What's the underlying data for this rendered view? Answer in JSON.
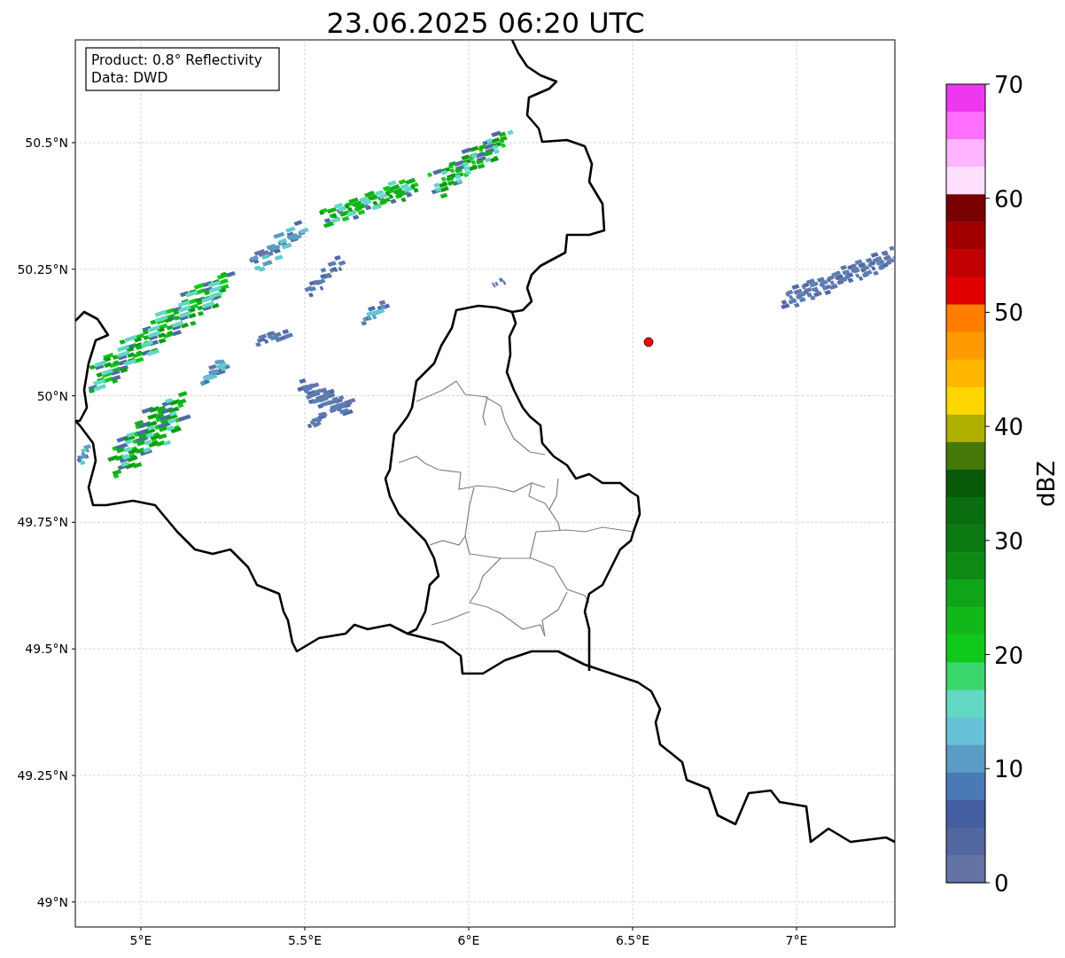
{
  "title": "23.06.2025 06:20 UTC",
  "info_box": [
    "Product: 0.8° Reflectivity",
    "Data: DWD"
  ],
  "map": {
    "y_ticks": [
      "50.5°N",
      "50.25°N",
      "50°N",
      "49.75°N",
      "49.5°N",
      "49.25°N",
      "49°N"
    ],
    "x_ticks": [
      "5°E",
      "5.5°E",
      "6°E",
      "6.5°E",
      "7°E"
    ]
  },
  "colorbar": {
    "label": "dBZ",
    "ticks": [
      "70",
      "60",
      "50",
      "40",
      "30",
      "20",
      "10",
      "0"
    ],
    "bands": [
      {
        "color": "#ee38ee"
      },
      {
        "color": "#ff6eff"
      },
      {
        "color": "#ffb4ff"
      },
      {
        "color": "#ffe0ff"
      },
      {
        "color": "#780000"
      },
      {
        "color": "#a00000"
      },
      {
        "color": "#c00000"
      },
      {
        "color": "#e00000"
      },
      {
        "color": "#ff7e00"
      },
      {
        "color": "#ff9a00"
      },
      {
        "color": "#ffb700"
      },
      {
        "color": "#ffd700"
      },
      {
        "color": "#b0b000"
      },
      {
        "color": "#457808"
      },
      {
        "color": "#085a0a"
      },
      {
        "color": "#0a6e10"
      },
      {
        "color": "#0c7a12"
      },
      {
        "color": "#0e8a14"
      },
      {
        "color": "#10a418"
      },
      {
        "color": "#12b81a"
      },
      {
        "color": "#10c81a"
      },
      {
        "color": "#3cd66e"
      },
      {
        "color": "#62d8c4"
      },
      {
        "color": "#65c2d8"
      },
      {
        "color": "#5a9cc5"
      },
      {
        "color": "#4a7ab5"
      },
      {
        "color": "#435fa2"
      },
      {
        "color": "#52679f"
      },
      {
        "color": "#6473a6"
      }
    ]
  }
}
